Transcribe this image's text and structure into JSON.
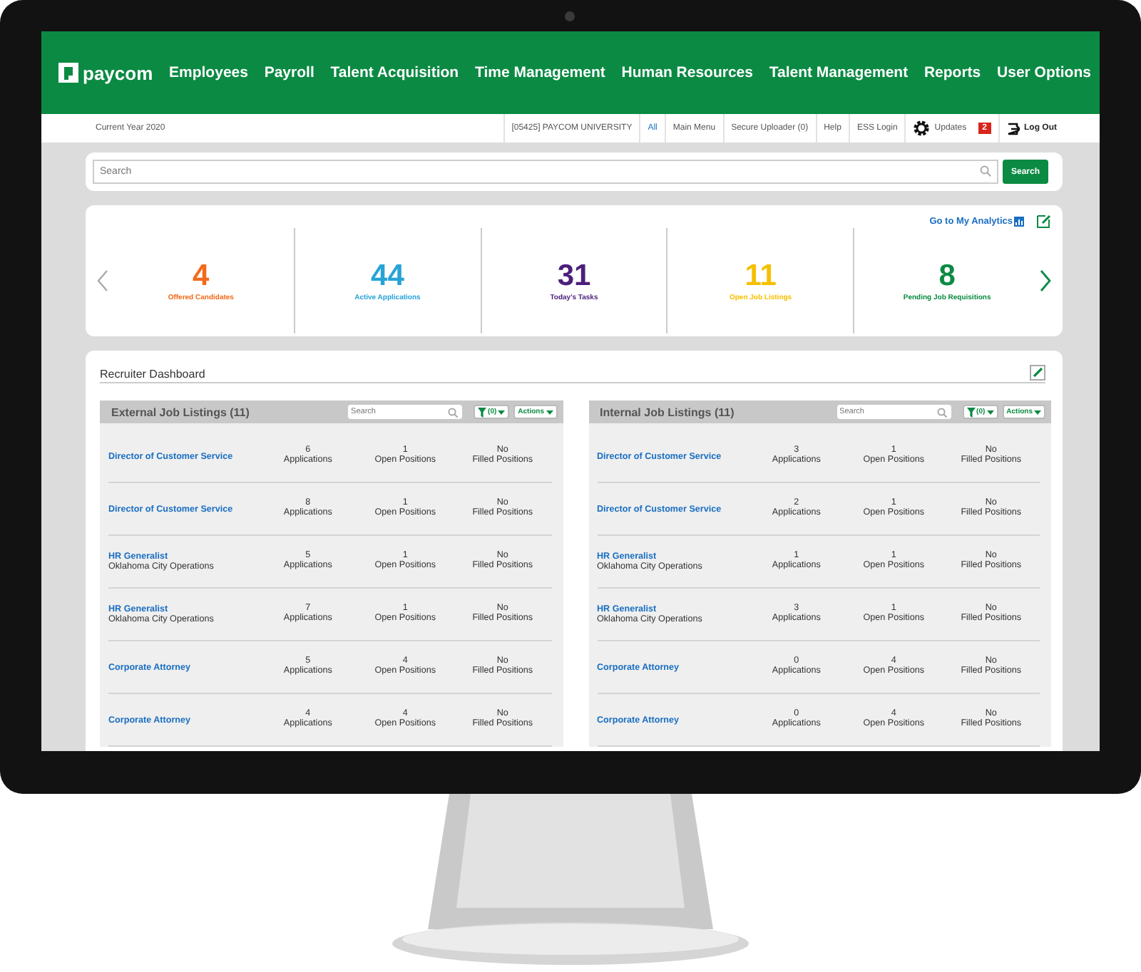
{
  "brand": "paycom",
  "nav": [
    "Employees",
    "Payroll",
    "Talent Acquisition",
    "Time Management",
    "Human Resources",
    "Talent Management",
    "Reports",
    "User Options"
  ],
  "subbar": {
    "left": "Current Year 2020",
    "links": [
      "[05425] PAYCOM UNIVERSITY",
      "All",
      "Main Menu",
      "Secure Uploader (0)",
      "Help",
      "ESS Login"
    ],
    "updates": "Updates",
    "updates_count": "2",
    "logout": "Log Out"
  },
  "search": {
    "placeholder": "Search",
    "button": "Search"
  },
  "analytics_link": "Go to My Analytics",
  "metrics": [
    {
      "value": "4",
      "label": "Offered Candidates",
      "color": "#f26a1b"
    },
    {
      "value": "44",
      "label": "Active Applications",
      "color": "#27a3d6"
    },
    {
      "value": "31",
      "label": "Today's Tasks",
      "color": "#4b1f7a"
    },
    {
      "value": "11",
      "label": "Open Job Listings",
      "color": "#f5c000"
    },
    {
      "value": "8",
      "label": "Pending Job Requisitions",
      "color": "#0b8a43"
    }
  ],
  "dashboard": {
    "title": "Recruiter Dashboard",
    "panels": [
      {
        "title": "External Job Listings (11)",
        "search_placeholder": "Search",
        "filter": "(0)",
        "actions": "Actions",
        "rows": [
          {
            "title": "Director of Customer Service",
            "stats": [
              [
                "6",
                "Applications"
              ],
              [
                "1",
                "Open Positions"
              ],
              [
                "No",
                "Filled Positions"
              ]
            ]
          },
          {
            "title": "Director of Customer Service",
            "stats": [
              [
                "8",
                "Applications"
              ],
              [
                "1",
                "Open Positions"
              ],
              [
                "No",
                "Filled Positions"
              ]
            ]
          },
          {
            "title": "HR Generalist",
            "subtitle": "Oklahoma City Operations",
            "stats": [
              [
                "5",
                "Applications"
              ],
              [
                "1",
                "Open Positions"
              ],
              [
                "No",
                "Filled Positions"
              ]
            ]
          },
          {
            "title": "HR Generalist",
            "subtitle": "Oklahoma City Operations",
            "stats": [
              [
                "7",
                "Applications"
              ],
              [
                "1",
                "Open Positions"
              ],
              [
                "No",
                "Filled Positions"
              ]
            ]
          },
          {
            "title": "Corporate Attorney",
            "stats": [
              [
                "5",
                "Applications"
              ],
              [
                "4",
                "Open Positions"
              ],
              [
                "No",
                "Filled Positions"
              ]
            ]
          },
          {
            "title": "Corporate Attorney",
            "stats": [
              [
                "4",
                "Applications"
              ],
              [
                "4",
                "Open Positions"
              ],
              [
                "No",
                "Filled Positions"
              ]
            ]
          }
        ]
      },
      {
        "title": "Internal Job Listings (11)",
        "search_placeholder": "Search",
        "filter": "(0)",
        "actions": "Actions",
        "rows": [
          {
            "title": "Director of Customer Service",
            "stats": [
              [
                "3",
                "Applications"
              ],
              [
                "1",
                "Open Positions"
              ],
              [
                "No",
                "Filled Positions"
              ]
            ]
          },
          {
            "title": "Director of Customer Service",
            "stats": [
              [
                "2",
                "Applications"
              ],
              [
                "1",
                "Open Positions"
              ],
              [
                "No",
                "Filled Positions"
              ]
            ]
          },
          {
            "title": "HR Generalist",
            "subtitle": "Oklahoma City Operations",
            "stats": [
              [
                "1",
                "Applications"
              ],
              [
                "1",
                "Open Positions"
              ],
              [
                "No",
                "Filled Positions"
              ]
            ]
          },
          {
            "title": "HR Generalist",
            "subtitle": "Oklahoma City Operations",
            "stats": [
              [
                "3",
                "Applications"
              ],
              [
                "1",
                "Open Positions"
              ],
              [
                "No",
                "Filled Positions"
              ]
            ]
          },
          {
            "title": "Corporate Attorney",
            "stats": [
              [
                "0",
                "Applications"
              ],
              [
                "4",
                "Open Positions"
              ],
              [
                "No",
                "Filled Positions"
              ]
            ]
          },
          {
            "title": "Corporate Attorney",
            "stats": [
              [
                "0",
                "Applications"
              ],
              [
                "4",
                "Open Positions"
              ],
              [
                "No",
                "Filled Positions"
              ]
            ]
          }
        ]
      }
    ]
  }
}
